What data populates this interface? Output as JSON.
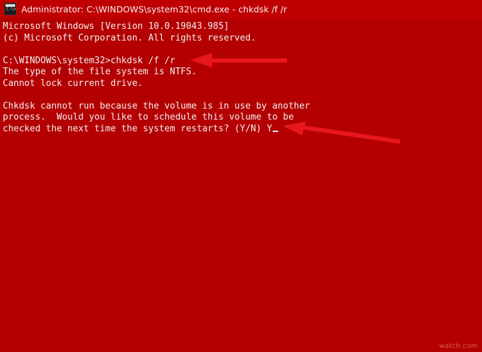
{
  "window": {
    "title": "Administrator: C:\\WINDOWS\\system32\\cmd.exe - chkdsk  /f /r",
    "icon": "cmd-console-icon",
    "prompt_glyph": "C:\\>"
  },
  "console": {
    "background_color": "#b40000",
    "text_color": "#f0f0f0",
    "lines": [
      "Microsoft Windows [Version 10.0.19043.985]",
      "(c) Microsoft Corporation. All rights reserved.",
      "",
      "C:\\WINDOWS\\system32>chkdsk /f /r",
      "The type of the file system is NTFS.",
      "Cannot lock current drive.",
      "",
      "Chkdsk cannot run because the volume is in use by another",
      "process.  Would you like to schedule this volume to be",
      "checked the next time the system restarts? (Y/N) Y"
    ],
    "cursor_after_line_index": 9
  },
  "annotations": {
    "color": "#e8171b",
    "arrows": [
      {
        "name": "arrow-to-chkdsk-command",
        "points_to": "chkdsk /f /r"
      },
      {
        "name": "arrow-to-yn-answer",
        "points_to": "(Y/N) Y"
      }
    ]
  },
  "watermark": {
    "text": "watch.com"
  }
}
